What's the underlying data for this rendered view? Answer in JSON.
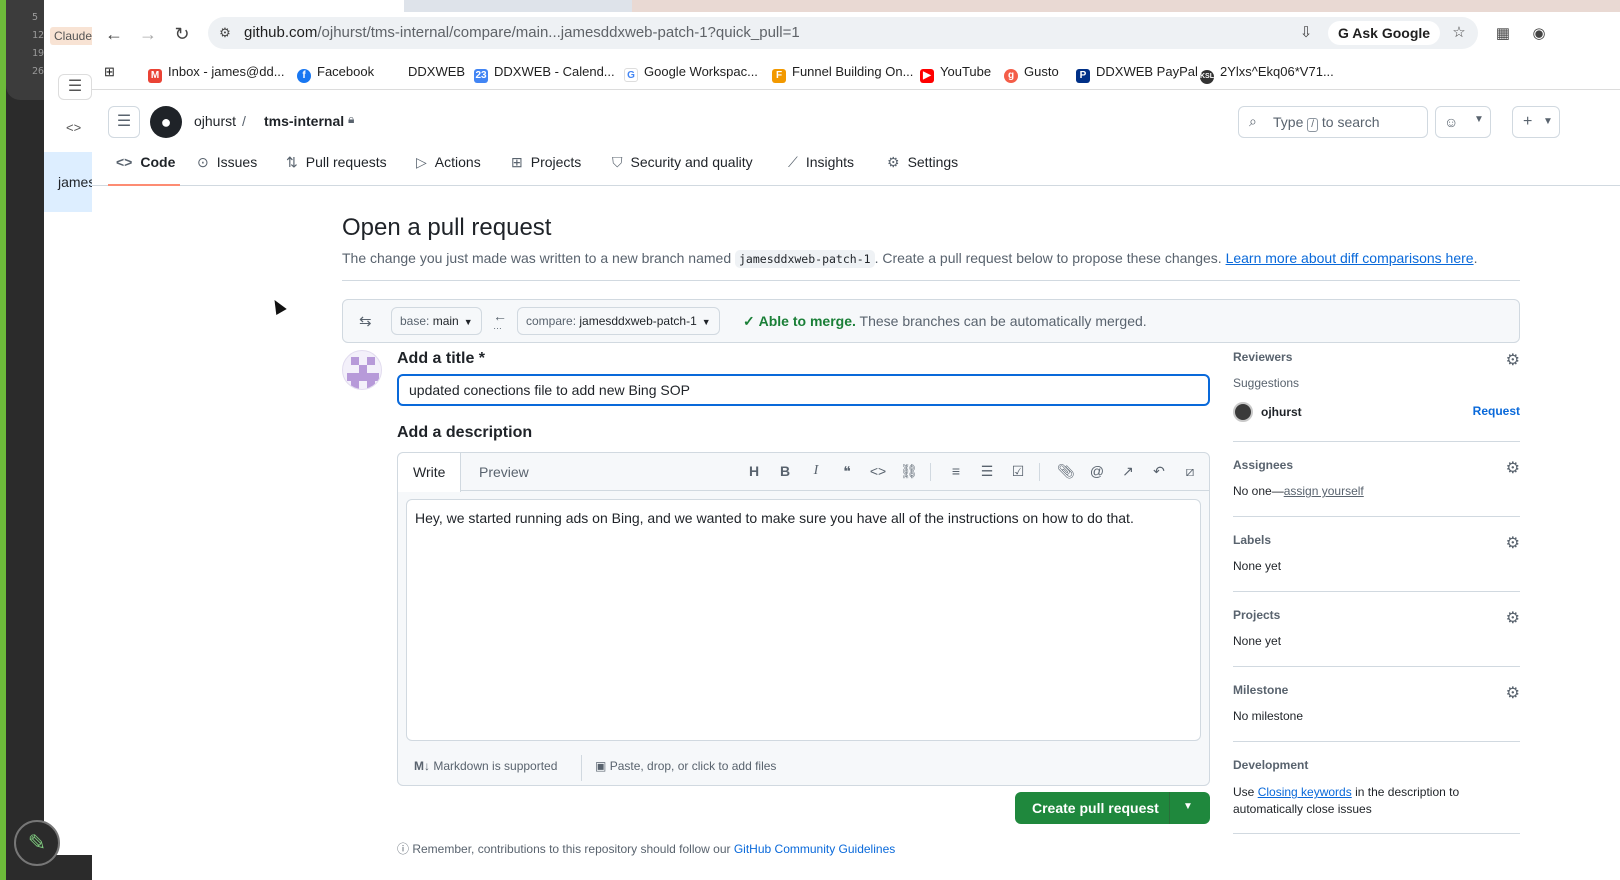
{
  "background": {
    "line_numbers": [
      "5",
      "12",
      "19",
      "26"
    ],
    "claude_tab": "Claude",
    "sidebar_user": "james"
  },
  "browser": {
    "url_host": "github.com",
    "url_path": "/ojhurst/tms-internal/compare/main...jamesddxweb-patch-1?quick_pull=1",
    "ask_google": "Ask Google",
    "bookmarks": [
      {
        "label": "Inbox - james@dd...",
        "icon": "gmail-icon",
        "color": "#ea4335"
      },
      {
        "label": "Facebook",
        "icon": "facebook-icon",
        "color": "#1877f2"
      },
      {
        "label": "DDXWEB",
        "icon": "",
        "color": ""
      },
      {
        "label": "DDXWEB - Calend...",
        "icon": "calendar-icon",
        "color": "#4285f4"
      },
      {
        "label": "Google Workspac...",
        "icon": "google-icon",
        "color": "#4285f4"
      },
      {
        "label": "Funnel Building On...",
        "icon": "funnel-icon",
        "color": "#f29900"
      },
      {
        "label": "YouTube",
        "icon": "youtube-icon",
        "color": "#ff0000"
      },
      {
        "label": "Gusto",
        "icon": "gusto-icon",
        "color": "#f45d48"
      },
      {
        "label": "DDXWEB PayPal",
        "icon": "paypal-icon",
        "color": "#003087"
      },
      {
        "label": "2Ylxs^Ekq06*V71...",
        "icon": "ksl-icon",
        "color": "#333333"
      }
    ]
  },
  "github": {
    "owner": "ojhurst",
    "repo": "tms-internal",
    "search_prefix": "Type",
    "search_key": "/",
    "search_suffix": "to search",
    "tabs": [
      {
        "label": "Code",
        "icon": "code-icon",
        "glyph": "<>",
        "name": "tab-code"
      },
      {
        "label": "Issues",
        "icon": "issue-icon",
        "glyph": "⊙",
        "name": "tab-issues"
      },
      {
        "label": "Pull requests",
        "icon": "pull-request-icon",
        "glyph": "⇅",
        "name": "tab-pull-requests"
      },
      {
        "label": "Actions",
        "icon": "play-icon",
        "glyph": "▷",
        "name": "tab-actions"
      },
      {
        "label": "Projects",
        "icon": "table-icon",
        "glyph": "⊞",
        "name": "tab-projects"
      },
      {
        "label": "Security and quality",
        "icon": "shield-icon",
        "glyph": "⛉",
        "name": "tab-security"
      },
      {
        "label": "Insights",
        "icon": "graph-icon",
        "glyph": "⟋",
        "name": "tab-insights"
      },
      {
        "label": "Settings",
        "icon": "gear-icon",
        "glyph": "⚙",
        "name": "tab-settings"
      }
    ]
  },
  "main": {
    "title": "Open a pull request",
    "intro_before": "The change you just made was written to a new branch named",
    "branch_code": "jamesddxweb-patch-1",
    "intro_after": ". Create a pull request below to propose these changes.",
    "intro_link": "Learn more about diff comparisons here",
    "intro_end": ".",
    "base_label": "base:",
    "base_value": "main",
    "compare_label": "compare:",
    "compare_value": "jamesddxweb-patch-1",
    "merge_ok": "Able to merge.",
    "merge_text": "These branches can be automatically merged.",
    "title_label": "Add a title *",
    "title_value": "updated conections file to add new Bing SOP",
    "desc_label": "Add a description",
    "tab_write": "Write",
    "tab_preview": "Preview",
    "description": "Hey, we started running ads on Bing, and we wanted to make sure you have all of the instructions on how to do that.",
    "markdown_note": "Markdown is supported",
    "files_note": "Paste, drop, or click to add files",
    "create_button": "Create pull request",
    "reminder_text": "Remember, contributions to this repository should follow our",
    "reminder_link": "GitHub Community Guidelines"
  },
  "sidebar": {
    "reviewers": "Reviewers",
    "suggestions": "Suggestions",
    "suggested_user": "ojhurst",
    "request": "Request",
    "assignees": "Assignees",
    "assignees_none": "No one—",
    "assign_yourself": "assign yourself",
    "labels": "Labels",
    "labels_value": "None yet",
    "projects": "Projects",
    "projects_value": "None yet",
    "milestone": "Milestone",
    "milestone_value": "No milestone",
    "development": "Development",
    "dev_use": "Use",
    "dev_link": "Closing keywords",
    "dev_rest": "in the description to automatically close issues"
  }
}
